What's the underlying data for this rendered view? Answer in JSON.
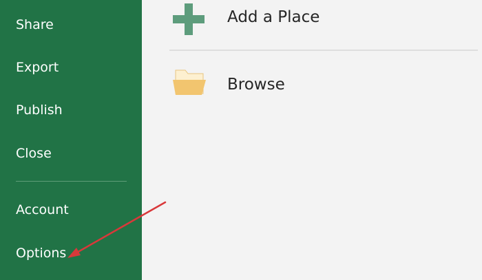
{
  "sidebar": {
    "items": [
      {
        "label": "Share"
      },
      {
        "label": "Export"
      },
      {
        "label": "Publish"
      },
      {
        "label": "Close"
      },
      {
        "label": "Account"
      },
      {
        "label": "Options"
      }
    ]
  },
  "places": {
    "add_place": {
      "label": "Add a Place",
      "icon": "plus-icon"
    },
    "browse": {
      "label": "Browse",
      "icon": "folder-icon"
    }
  },
  "colors": {
    "sidebar_bg": "#217346",
    "content_bg": "#f3f3f3",
    "plus_icon": "#5d9c7c",
    "folder_icon": "#f2c56f",
    "arrow": "#d9383a"
  },
  "annotation": {
    "type": "arrow",
    "points_to": "Options"
  }
}
